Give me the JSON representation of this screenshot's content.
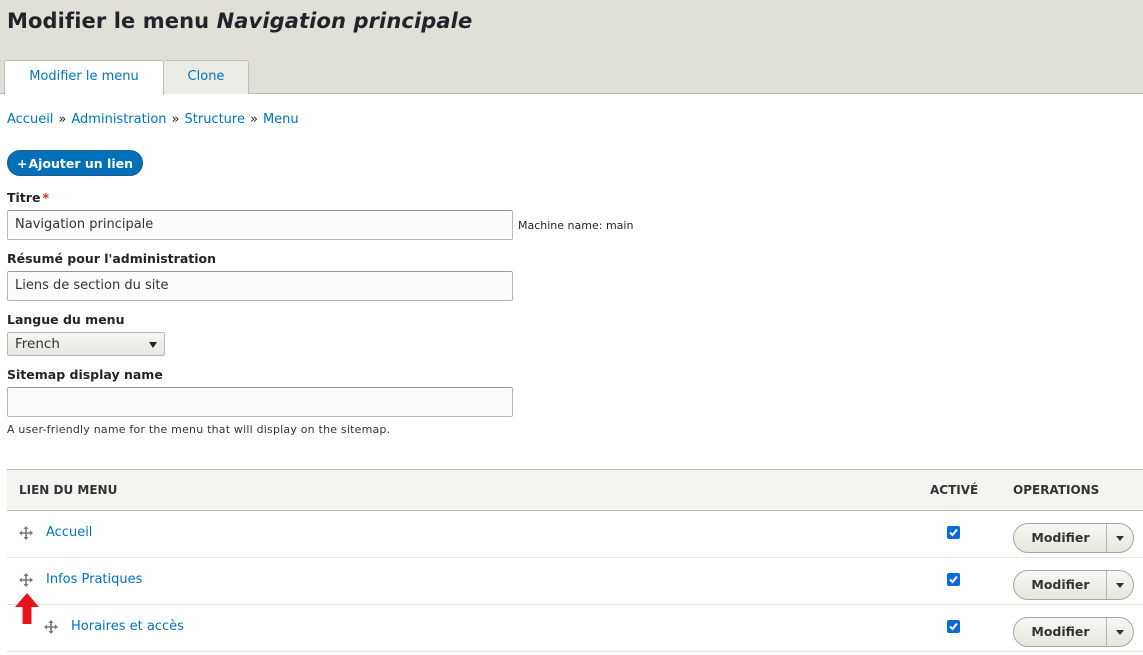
{
  "page": {
    "title_prefix": "Modifier le menu ",
    "title_menu_name": "Navigation principale"
  },
  "tabs": [
    {
      "label": "Modifier le menu",
      "active": true
    },
    {
      "label": "Clone",
      "active": false
    }
  ],
  "breadcrumb": {
    "items": [
      "Accueil",
      "Administration",
      "Structure",
      "Menu"
    ],
    "separator": "»"
  },
  "add_link_button": {
    "icon": "+",
    "label": "Ajouter un lien"
  },
  "form": {
    "title_label": "Titre",
    "required_marker": "*",
    "title_value": "Navigation principale",
    "machine_name": "Machine name: main",
    "summary_label": "Résumé pour l'administration",
    "summary_value": "Liens de section du site",
    "language_label": "Langue du menu",
    "language_value": "French",
    "sitemap_label": "Sitemap display name",
    "sitemap_value": "",
    "sitemap_description": "A user-friendly name for the menu that will display on the sitemap."
  },
  "table": {
    "headers": {
      "link": "LIEN DU MENU",
      "enabled": "ACTIVÉ",
      "operations": "OPERATIONS"
    },
    "rows": [
      {
        "label": "Accueil",
        "enabled": true,
        "operation": "Modifier",
        "depth": 0
      },
      {
        "label": "Infos Pratiques",
        "enabled": true,
        "operation": "Modifier",
        "depth": 0
      },
      {
        "label": "Horaires et accès",
        "enabled": true,
        "operation": "Modifier",
        "depth": 1
      }
    ]
  },
  "colors": {
    "accent": "#0074bd",
    "button_blue": "#0071b8",
    "header_bg": "#e0e0d8",
    "annotation_arrow": "#e8131c"
  },
  "icons": {
    "drag": "drag-handle-icon",
    "annotation": "red-arrow-up-icon",
    "checkbox": "checkmark-icon",
    "dropdown": "chevron-down-icon"
  }
}
